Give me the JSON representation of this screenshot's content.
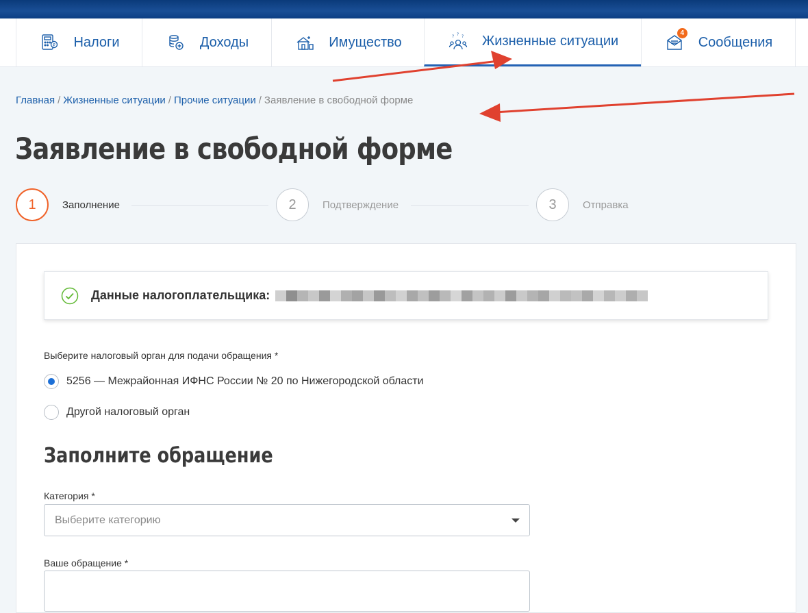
{
  "nav": {
    "items": [
      {
        "label": "Налоги",
        "icon": "calculator-icon"
      },
      {
        "label": "Доходы",
        "icon": "coins-icon"
      },
      {
        "label": "Имущество",
        "icon": "property-icon"
      },
      {
        "label": "Жизненные ситуации",
        "icon": "people-icon",
        "active": true
      },
      {
        "label": "Сообщения",
        "icon": "envelope-icon",
        "badge": "4"
      }
    ]
  },
  "breadcrumb": {
    "items": [
      "Главная",
      "Жизненные ситуации",
      "Прочие ситуации"
    ],
    "current": "Заявление в свободной форме",
    "separator": "/"
  },
  "page": {
    "title": "Заявление в свободной форме"
  },
  "stepper": {
    "steps": [
      {
        "number": "1",
        "label": "Заполнение",
        "active": true
      },
      {
        "number": "2",
        "label": "Подтверждение"
      },
      {
        "number": "3",
        "label": "Отправка"
      }
    ]
  },
  "taxpayer": {
    "label": "Данные налогоплательщика:"
  },
  "tax_office": {
    "label": "Выберите налоговый орган для подачи обращения *",
    "options": [
      {
        "label": "5256 — Межрайонная ИФНС России № 20 по Нижегородской области",
        "selected": true
      },
      {
        "label": "Другой налоговый орган",
        "selected": false
      }
    ]
  },
  "appeal": {
    "section_title": "Заполните обращение",
    "category_label": "Категория *",
    "category_placeholder": "Выберите категорию",
    "message_label": "Ваше обращение *"
  },
  "colors": {
    "accent": "#f0632a",
    "link": "#1c5faa",
    "annotation_arrow": "#e0412f"
  }
}
